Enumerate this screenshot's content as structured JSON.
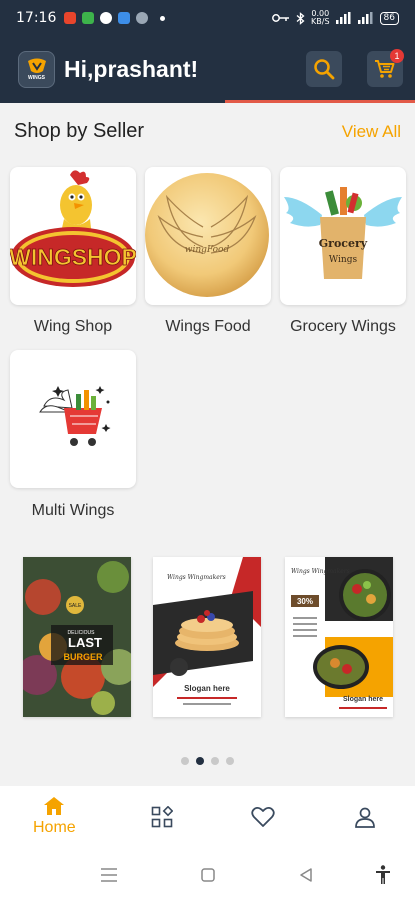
{
  "status_bar": {
    "time": "17:16",
    "network_speed": "0.00\nKB/S",
    "battery": "86"
  },
  "header": {
    "greeting": "Hi,prashant!",
    "logo_text": "WINGS",
    "cart_count": "1"
  },
  "section": {
    "title": "Shop by Seller",
    "view_all": "View All"
  },
  "sellers": [
    {
      "name": "Wing Shop",
      "logo_text": "WINGSHOP"
    },
    {
      "name": "Wings Food",
      "logo_text": "wingFood"
    },
    {
      "name": "Grocery Wings",
      "logo_text": "Grocery",
      "logo_subtext": "Wings"
    },
    {
      "name": "Multi Wings"
    }
  ],
  "banners": [
    {
      "title": "LAST",
      "subtitle": "BURGER",
      "top_text": "DELICIOUS",
      "badge": "SALE"
    },
    {
      "brand": "Wings Wingmakers",
      "slogan": "Slogan here"
    },
    {
      "brand": "Wings Wingmakers",
      "discount": "30%",
      "slogan": "Slogan here"
    }
  ],
  "carousel": {
    "count": 4,
    "active_index": 1
  },
  "bottom_nav": {
    "home_label": "Home"
  },
  "colors": {
    "header_bg": "#233041",
    "accent": "#f5a300",
    "badge": "#e53935"
  }
}
